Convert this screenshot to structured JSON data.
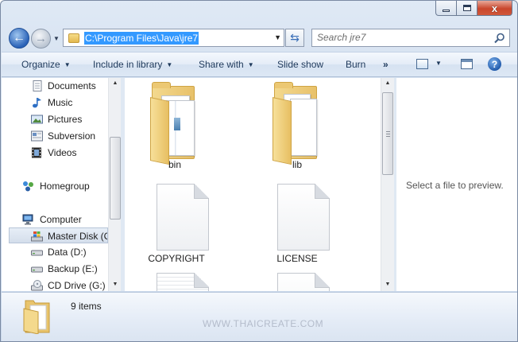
{
  "window": {
    "caption": {
      "minimize": "",
      "maximize": "",
      "close": "x"
    }
  },
  "address": {
    "path": "C:\\Program Files\\Java\\jre7",
    "search_placeholder": "Search jre7"
  },
  "toolbar": {
    "organize": "Organize",
    "include_in_library": "Include in library",
    "share_with": "Share with",
    "slide_show": "Slide show",
    "burn": "Burn",
    "more": "»",
    "help": "?"
  },
  "nav": {
    "libraries": [
      "Documents",
      "Music",
      "Pictures",
      "Subversion",
      "Videos"
    ],
    "homegroup": "Homegroup",
    "computer": "Computer",
    "drives": [
      "Master Disk (C",
      "Data (D:)",
      "Backup (E:)",
      "CD Drive (G:)"
    ]
  },
  "files": [
    "bin",
    "lib",
    "COPYRIGHT",
    "LICENSE"
  ],
  "preview": {
    "text": "Select a file to preview."
  },
  "details": {
    "count": "9 items"
  },
  "watermark": "WWW.THAICREATE.COM",
  "colors": {
    "selection": "#3399ff",
    "folder": "#e8c16a",
    "command_text": "#1e395b"
  }
}
